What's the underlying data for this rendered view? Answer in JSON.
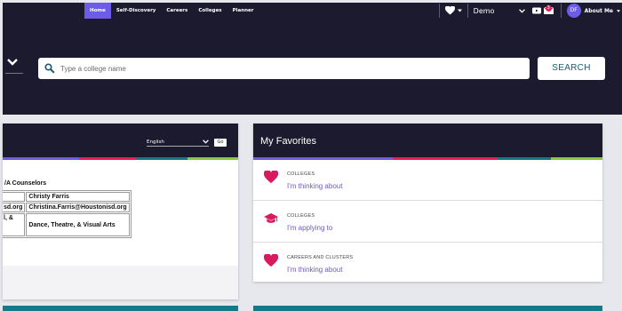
{
  "nav": {
    "items": [
      {
        "label": "Home",
        "active": true
      },
      {
        "label": "Self-Discovery",
        "active": false
      },
      {
        "label": "Careers",
        "active": false
      },
      {
        "label": "Colleges",
        "active": false
      },
      {
        "label": "Planner",
        "active": false
      }
    ]
  },
  "header_right": {
    "school_select": "Demo",
    "notification_count": "3",
    "avatar_initials": "DF",
    "user_menu_label": "About Me"
  },
  "search": {
    "placeholder": "Type a college name",
    "button_label": "SEARCH"
  },
  "language": {
    "selected": "English",
    "go_label": "Go"
  },
  "counselors": {
    "title": "/A Counselors",
    "rows": [
      [
        "",
        "Christy Farris"
      ],
      [
        "sd.org",
        "Christina.Farris@Houstonisd.org"
      ],
      [
        "l, &",
        "Dance, Theatre, & Visual Arts"
      ]
    ]
  },
  "favorites": {
    "title": "My Favorites",
    "items": [
      {
        "category": "COLLEGES",
        "link": "I'm thinking about",
        "icon": "heart-icon"
      },
      {
        "category": "COLLEGES",
        "link": "I'm applying to",
        "icon": "graduation-cap-icon"
      },
      {
        "category": "CAREERS AND CLUSTERS",
        "link": "I'm thinking about",
        "icon": "heart-icon"
      }
    ]
  },
  "colors": {
    "header_bg": "#1b1a2f",
    "nav_active": "#6d5ce8",
    "accent_pink": "#d81b60",
    "link_purple": "#6a5acd",
    "stripe_colors": [
      "#6d5ce8",
      "#e8205a",
      "#147a8a",
      "#8dc63f"
    ]
  }
}
